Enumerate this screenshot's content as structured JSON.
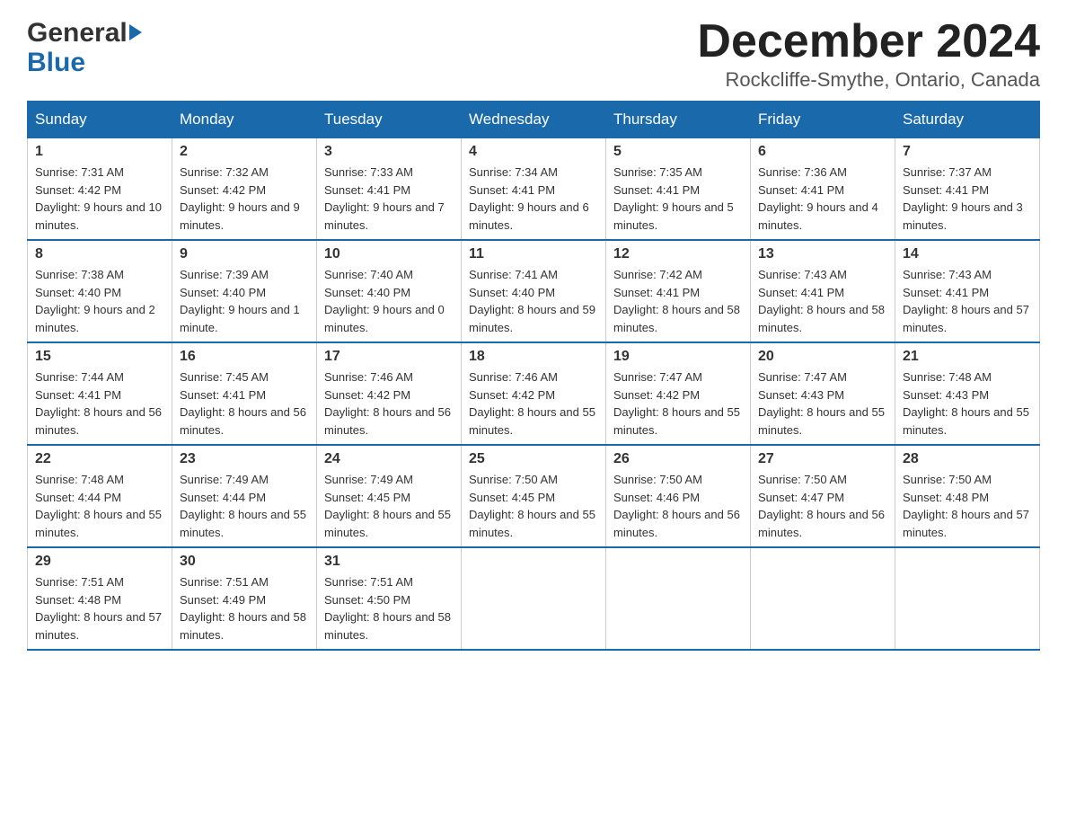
{
  "logo": {
    "line1": "General",
    "line2": "Blue"
  },
  "title": "December 2024",
  "location": "Rockcliffe-Smythe, Ontario, Canada",
  "weekdays": [
    "Sunday",
    "Monday",
    "Tuesday",
    "Wednesday",
    "Thursday",
    "Friday",
    "Saturday"
  ],
  "weeks": [
    [
      {
        "day": "1",
        "sunrise": "7:31 AM",
        "sunset": "4:42 PM",
        "daylight": "9 hours and 10 minutes."
      },
      {
        "day": "2",
        "sunrise": "7:32 AM",
        "sunset": "4:42 PM",
        "daylight": "9 hours and 9 minutes."
      },
      {
        "day": "3",
        "sunrise": "7:33 AM",
        "sunset": "4:41 PM",
        "daylight": "9 hours and 7 minutes."
      },
      {
        "day": "4",
        "sunrise": "7:34 AM",
        "sunset": "4:41 PM",
        "daylight": "9 hours and 6 minutes."
      },
      {
        "day": "5",
        "sunrise": "7:35 AM",
        "sunset": "4:41 PM",
        "daylight": "9 hours and 5 minutes."
      },
      {
        "day": "6",
        "sunrise": "7:36 AM",
        "sunset": "4:41 PM",
        "daylight": "9 hours and 4 minutes."
      },
      {
        "day": "7",
        "sunrise": "7:37 AM",
        "sunset": "4:41 PM",
        "daylight": "9 hours and 3 minutes."
      }
    ],
    [
      {
        "day": "8",
        "sunrise": "7:38 AM",
        "sunset": "4:40 PM",
        "daylight": "9 hours and 2 minutes."
      },
      {
        "day": "9",
        "sunrise": "7:39 AM",
        "sunset": "4:40 PM",
        "daylight": "9 hours and 1 minute."
      },
      {
        "day": "10",
        "sunrise": "7:40 AM",
        "sunset": "4:40 PM",
        "daylight": "9 hours and 0 minutes."
      },
      {
        "day": "11",
        "sunrise": "7:41 AM",
        "sunset": "4:40 PM",
        "daylight": "8 hours and 59 minutes."
      },
      {
        "day": "12",
        "sunrise": "7:42 AM",
        "sunset": "4:41 PM",
        "daylight": "8 hours and 58 minutes."
      },
      {
        "day": "13",
        "sunrise": "7:43 AM",
        "sunset": "4:41 PM",
        "daylight": "8 hours and 58 minutes."
      },
      {
        "day": "14",
        "sunrise": "7:43 AM",
        "sunset": "4:41 PM",
        "daylight": "8 hours and 57 minutes."
      }
    ],
    [
      {
        "day": "15",
        "sunrise": "7:44 AM",
        "sunset": "4:41 PM",
        "daylight": "8 hours and 56 minutes."
      },
      {
        "day": "16",
        "sunrise": "7:45 AM",
        "sunset": "4:41 PM",
        "daylight": "8 hours and 56 minutes."
      },
      {
        "day": "17",
        "sunrise": "7:46 AM",
        "sunset": "4:42 PM",
        "daylight": "8 hours and 56 minutes."
      },
      {
        "day": "18",
        "sunrise": "7:46 AM",
        "sunset": "4:42 PM",
        "daylight": "8 hours and 55 minutes."
      },
      {
        "day": "19",
        "sunrise": "7:47 AM",
        "sunset": "4:42 PM",
        "daylight": "8 hours and 55 minutes."
      },
      {
        "day": "20",
        "sunrise": "7:47 AM",
        "sunset": "4:43 PM",
        "daylight": "8 hours and 55 minutes."
      },
      {
        "day": "21",
        "sunrise": "7:48 AM",
        "sunset": "4:43 PM",
        "daylight": "8 hours and 55 minutes."
      }
    ],
    [
      {
        "day": "22",
        "sunrise": "7:48 AM",
        "sunset": "4:44 PM",
        "daylight": "8 hours and 55 minutes."
      },
      {
        "day": "23",
        "sunrise": "7:49 AM",
        "sunset": "4:44 PM",
        "daylight": "8 hours and 55 minutes."
      },
      {
        "day": "24",
        "sunrise": "7:49 AM",
        "sunset": "4:45 PM",
        "daylight": "8 hours and 55 minutes."
      },
      {
        "day": "25",
        "sunrise": "7:50 AM",
        "sunset": "4:45 PM",
        "daylight": "8 hours and 55 minutes."
      },
      {
        "day": "26",
        "sunrise": "7:50 AM",
        "sunset": "4:46 PM",
        "daylight": "8 hours and 56 minutes."
      },
      {
        "day": "27",
        "sunrise": "7:50 AM",
        "sunset": "4:47 PM",
        "daylight": "8 hours and 56 minutes."
      },
      {
        "day": "28",
        "sunrise": "7:50 AM",
        "sunset": "4:48 PM",
        "daylight": "8 hours and 57 minutes."
      }
    ],
    [
      {
        "day": "29",
        "sunrise": "7:51 AM",
        "sunset": "4:48 PM",
        "daylight": "8 hours and 57 minutes."
      },
      {
        "day": "30",
        "sunrise": "7:51 AM",
        "sunset": "4:49 PM",
        "daylight": "8 hours and 58 minutes."
      },
      {
        "day": "31",
        "sunrise": "7:51 AM",
        "sunset": "4:50 PM",
        "daylight": "8 hours and 58 minutes."
      },
      null,
      null,
      null,
      null
    ]
  ],
  "labels": {
    "sunrise": "Sunrise:",
    "sunset": "Sunset:",
    "daylight": "Daylight:"
  }
}
